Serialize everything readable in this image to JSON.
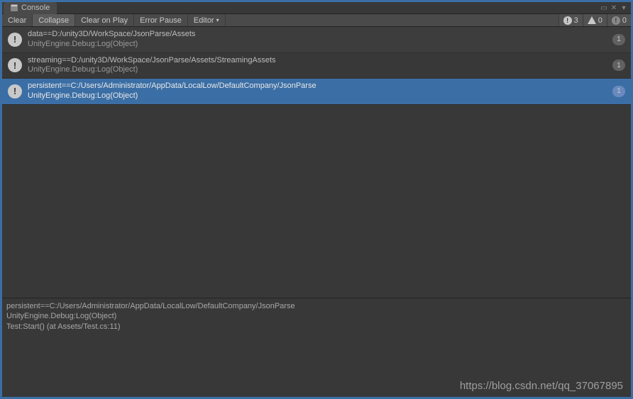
{
  "tab": {
    "title": "Console"
  },
  "toolbar": {
    "clear": "Clear",
    "collapse": "Collapse",
    "clearOnPlay": "Clear on Play",
    "errorPause": "Error Pause",
    "editor": "Editor"
  },
  "counters": {
    "info": "3",
    "warn": "0",
    "error": "0"
  },
  "logs": [
    {
      "line1": "data==D:/unity3D/WorkSpace/JsonParse/Assets",
      "line2": "UnityEngine.Debug:Log(Object)",
      "count": "1"
    },
    {
      "line1": "streaming==D:/unity3D/WorkSpace/JsonParse/Assets/StreamingAssets",
      "line2": "UnityEngine.Debug:Log(Object)",
      "count": "1"
    },
    {
      "line1": "persistent==C:/Users/Administrator/AppData/LocalLow/DefaultCompany/JsonParse",
      "line2": "UnityEngine.Debug:Log(Object)",
      "count": "1"
    }
  ],
  "detail": {
    "l1": "persistent==C:/Users/Administrator/AppData/LocalLow/DefaultCompany/JsonParse",
    "l2": "UnityEngine.Debug:Log(Object)",
    "l3": "Test:Start() (at Assets/Test.cs:11)"
  },
  "watermark": "https://blog.csdn.net/qq_37067895"
}
